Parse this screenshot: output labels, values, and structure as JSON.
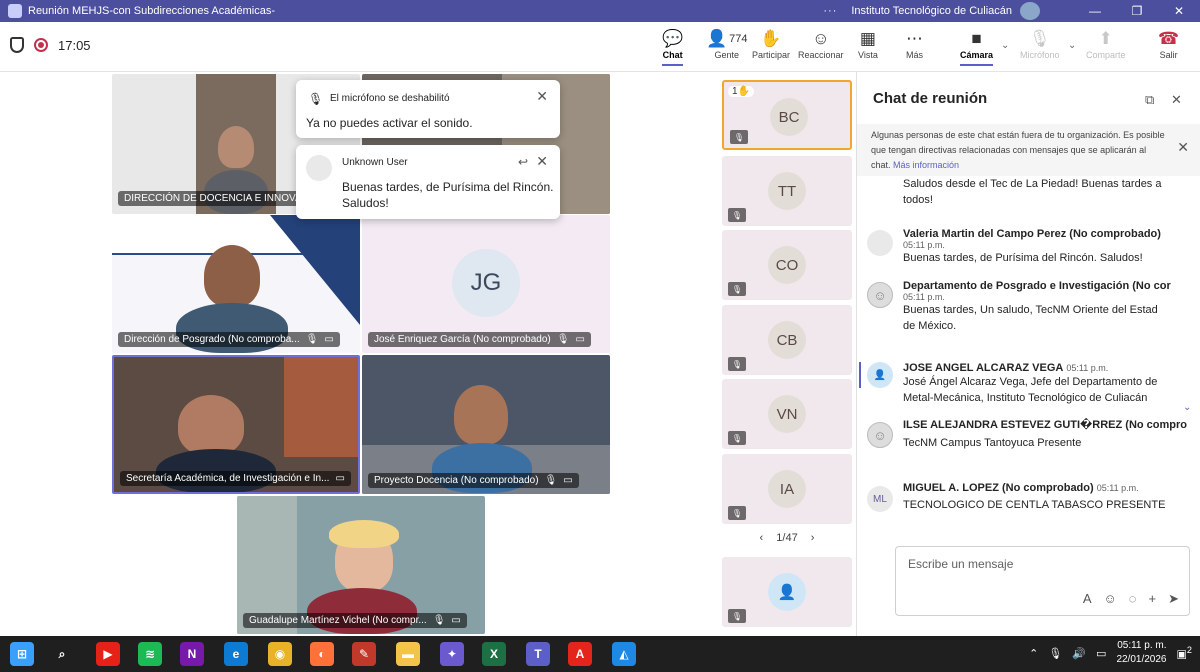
{
  "window": {
    "title": "Reunión MEHJS-con Subdirecciones Académicas-",
    "organization": "Instituto Tecnológico de Culiacán",
    "controls": [
      "—",
      "❐",
      "✕"
    ]
  },
  "toolbar": {
    "timer": "17:05",
    "buttons": [
      {
        "label": "Chat",
        "icon": "chat-icon",
        "glyph": "💬",
        "count": ""
      },
      {
        "label": "Gente",
        "icon": "people-icon",
        "glyph": "👤",
        "count": "774"
      },
      {
        "label": "Participar",
        "icon": "raise-hand-icon",
        "glyph": "✋",
        "count": ""
      },
      {
        "label": "Reaccionar",
        "icon": "smile-icon",
        "glyph": "☺",
        "count": ""
      },
      {
        "label": "Vista",
        "icon": "grid-icon",
        "glyph": "▦",
        "count": ""
      },
      {
        "label": "Más",
        "icon": "more-icon",
        "glyph": "⋯",
        "count": ""
      },
      {
        "label": "Cámara",
        "icon": "camera-off-icon",
        "glyph": "■",
        "count": ""
      },
      {
        "label": "Micrófono",
        "icon": "mic-off-icon",
        "glyph": "🎙",
        "count": ""
      },
      {
        "label": "Comparte",
        "icon": "share-icon",
        "glyph": "⬆",
        "count": ""
      },
      {
        "label": "Salir",
        "icon": "hangup-icon",
        "glyph": "☎",
        "count": ""
      }
    ]
  },
  "notifications": {
    "mic": {
      "title": "El micrófono se deshabilitó",
      "body": "Ya no puedes activar el sonido."
    },
    "message": {
      "sender": "Unknown User",
      "body_line1": "Buenas tardes,  de Purísima del Rincón.",
      "body_line2": "Saludos!"
    }
  },
  "videos": [
    {
      "name": "DIRECCIÓN DE DOCENCIA E INNOVAC..."
    },
    {
      "name": "Dirección de Posgrado (No comproba..."
    },
    {
      "name": "José Enriquez García (No comprobado)",
      "initials": "JG"
    },
    {
      "name": "Secretaría Académica, de Investigación e In..."
    },
    {
      "name": "Proyecto Docencia (No comprobado)"
    },
    {
      "name": "Guadalupe Martínez Vichel (No compr..."
    }
  ],
  "participants": {
    "raised_count": "1",
    "tiles": [
      "BC",
      "TT",
      "CO",
      "CB",
      "VN",
      "IA"
    ],
    "pager": "1/47"
  },
  "chat": {
    "title": "Chat de reunión",
    "banner": "Algunas personas de este chat están fuera de tu organización. Es posible que tengan directivas relacionadas con mensajes que se aplicarán al chat.",
    "banner_link": "Más información",
    "messages": [
      {
        "sender": "",
        "time": "",
        "avatar": "",
        "lines": [
          "Saludos desde el Tec de La Piedad! Buenas tardes a",
          "todos!"
        ]
      },
      {
        "sender": "Valeria Martin del Campo Perez (No comprobado)",
        "time": "05:11 p.m.",
        "avatar": "",
        "lines": [
          "Buenas tardes,  de Purísima del Rincón. Saludos!"
        ]
      },
      {
        "sender": "Departamento de Posgrado e Investigación (No cor",
        "time": "05:11 p.m.",
        "avatar": "",
        "lines": [
          "Buenas tardes, Un saludo, TecNM Oriente del Estad",
          "de México."
        ]
      },
      {
        "sender": "JOSE ANGEL ALCARAZ VEGA",
        "time": "05:11 p.m.",
        "avatar": "",
        "lines": [
          "José Ángel Alcaraz Vega, Jefe del Departamento de",
          "Metal-Mecánica, Instituto Tecnológico de Culiacán"
        ]
      },
      {
        "sender": "ILSE ALEJANDRA ESTEVEZ GUTI�RREZ (No compro",
        "time": "",
        "avatar": "",
        "lines": [
          "TecNM Campus Tantoyuca Presente"
        ]
      },
      {
        "sender": "MIGUEL A. LOPEZ (No comprobado)",
        "time": "05:11 p.m.",
        "avatar": "ML",
        "lines": [
          "TECNOLOGICO DE CENTLA TABASCO PRESENTE"
        ]
      }
    ],
    "compose_placeholder": "Escribe un mensaje"
  },
  "taskbar": {
    "time": "05:11 p. m.",
    "date": "22/01/2026",
    "notif_count": "2",
    "apps": [
      {
        "name": "start-icon",
        "color": "#3aa0ff",
        "glyph": "⊞"
      },
      {
        "name": "search-icon",
        "color": "#1f1f1f",
        "glyph": "⌕"
      },
      {
        "name": "youtube-icon",
        "color": "#e62117",
        "glyph": "▶"
      },
      {
        "name": "spotify-icon",
        "color": "#1db954",
        "glyph": "≋"
      },
      {
        "name": "onenote-icon",
        "color": "#7719aa",
        "glyph": "N"
      },
      {
        "name": "edge-icon",
        "color": "#0c7bd1",
        "glyph": "e"
      },
      {
        "name": "chrome-icon",
        "color": "#e8b32a",
        "glyph": "◉"
      },
      {
        "name": "firefox-icon",
        "color": "#ff7139",
        "glyph": "◐"
      },
      {
        "name": "pin-icon",
        "color": "#c0392b",
        "glyph": "✎"
      },
      {
        "name": "folder-icon",
        "color": "#f2c54a",
        "glyph": "▬"
      },
      {
        "name": "copilot-icon",
        "color": "#6a5acd",
        "glyph": "✦"
      },
      {
        "name": "excel-icon",
        "color": "#1d7044",
        "glyph": "X"
      },
      {
        "name": "teams-icon",
        "color": "#5b5fc7",
        "glyph": "T"
      },
      {
        "name": "acrobat-icon",
        "color": "#e3251b",
        "glyph": "A"
      },
      {
        "name": "photos-icon",
        "color": "#1e88e5",
        "glyph": "◭"
      }
    ]
  }
}
